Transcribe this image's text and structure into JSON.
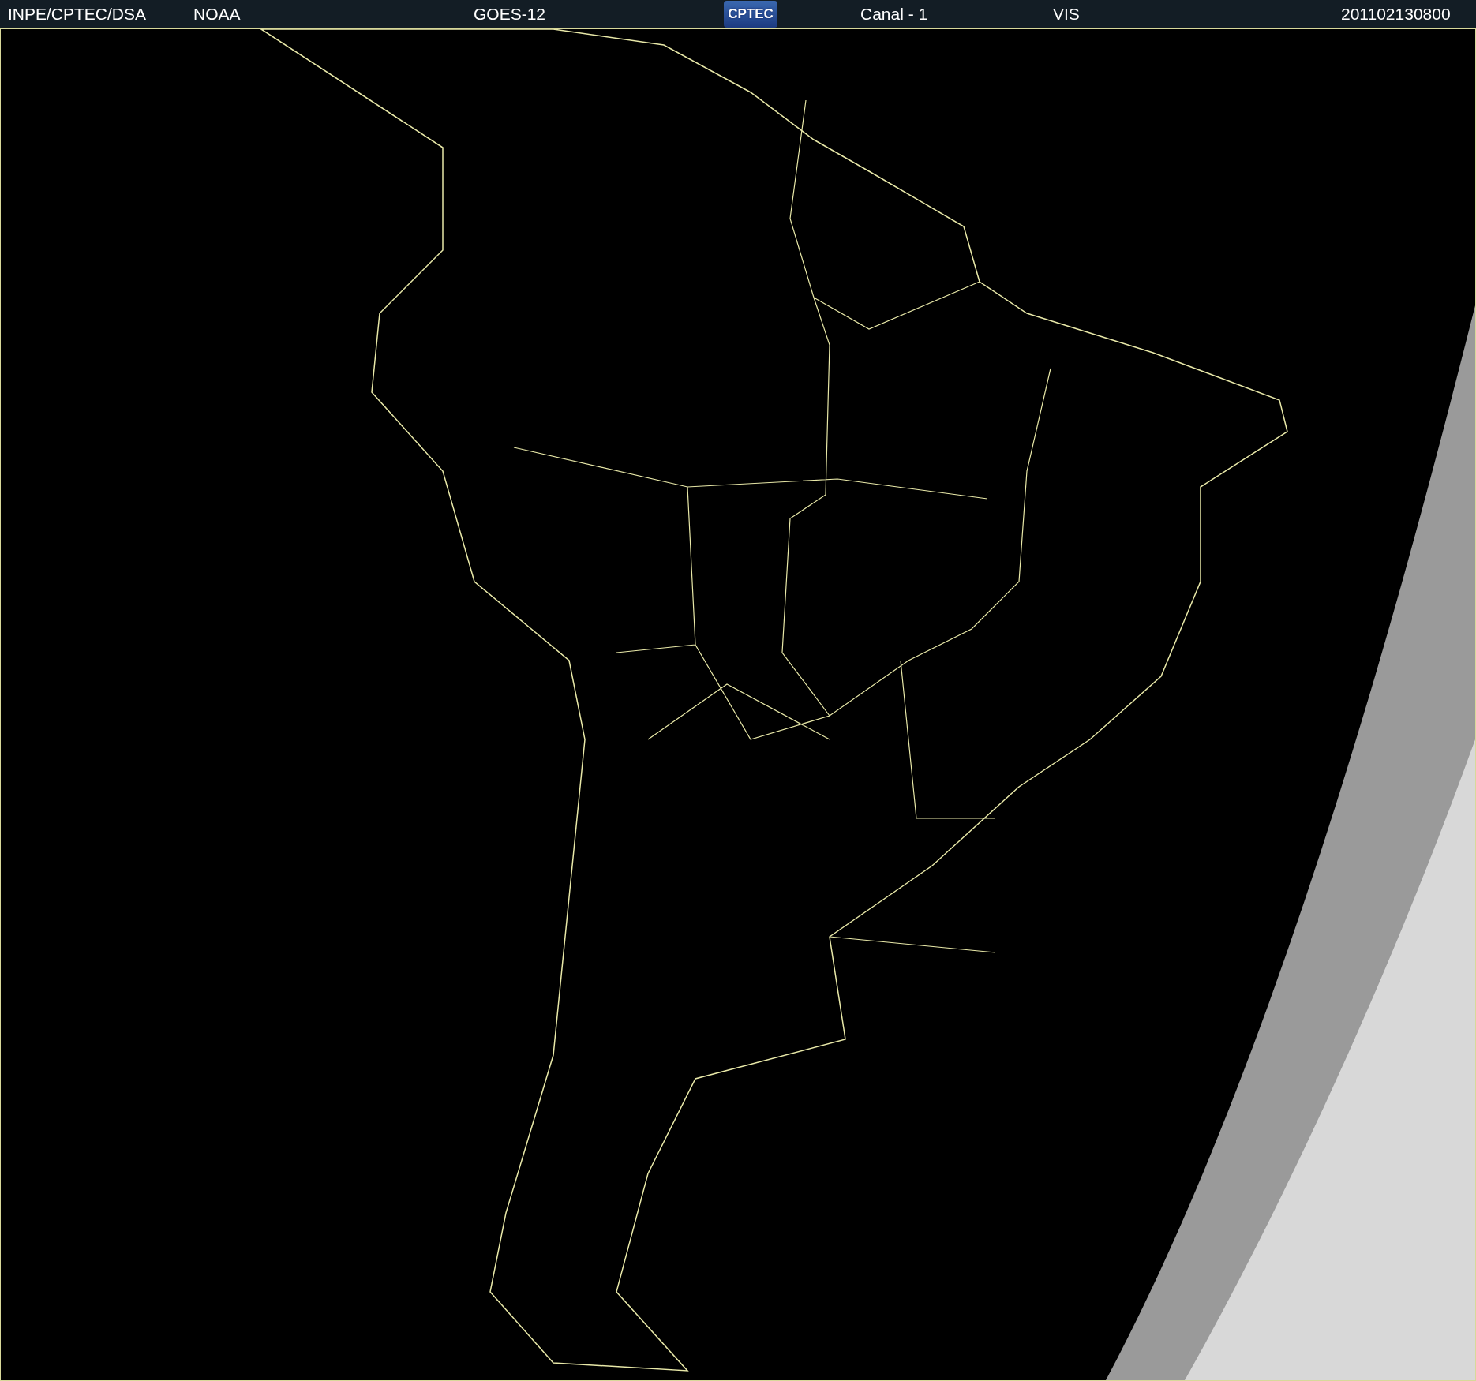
{
  "header": {
    "agency": "INPE/CPTEC/DSA",
    "operator": "NOAA",
    "satellite": "GOES-12",
    "logo_text": "CPTEC",
    "channel": "Canal - 1",
    "band": "VIS",
    "timestamp": "201102130800"
  }
}
